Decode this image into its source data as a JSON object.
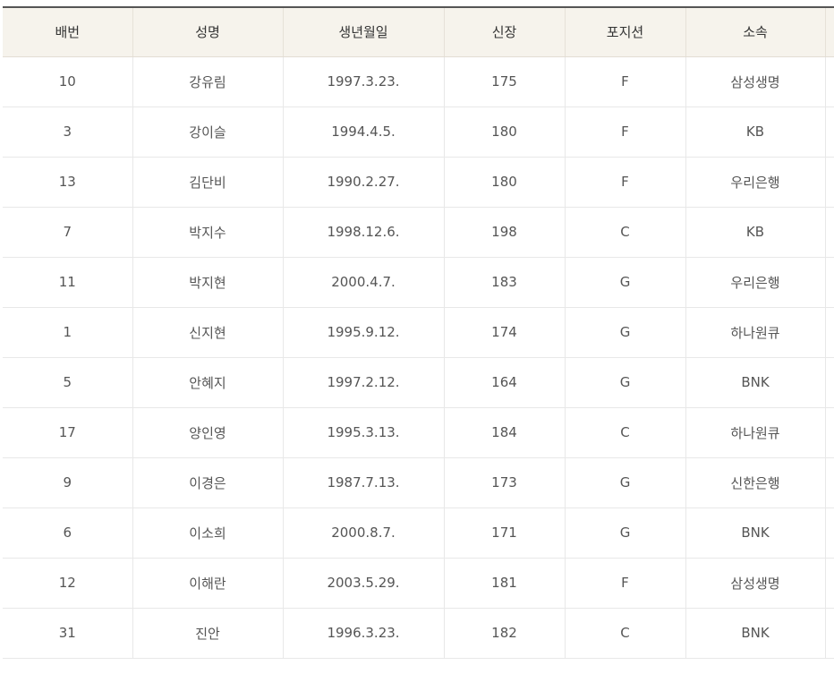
{
  "table": {
    "headers": [
      "배번",
      "성명",
      "생년월일",
      "신장",
      "포지션",
      "소속"
    ],
    "rows": [
      [
        "10",
        "강유림",
        "1997.3.23.",
        "175",
        "F",
        "삼성생명"
      ],
      [
        "3",
        "강이슬",
        "1994.4.5.",
        "180",
        "F",
        "KB"
      ],
      [
        "13",
        "김단비",
        "1990.2.27.",
        "180",
        "F",
        "우리은행"
      ],
      [
        "7",
        "박지수",
        "1998.12.6.",
        "198",
        "C",
        "KB"
      ],
      [
        "11",
        "박지현",
        "2000.4.7.",
        "183",
        "G",
        "우리은행"
      ],
      [
        "1",
        "신지현",
        "1995.9.12.",
        "174",
        "G",
        "하나원큐"
      ],
      [
        "5",
        "안혜지",
        "1997.2.12.",
        "164",
        "G",
        "BNK"
      ],
      [
        "17",
        "양인영",
        "1995.3.13.",
        "184",
        "C",
        "하나원큐"
      ],
      [
        "9",
        "이경은",
        "1987.7.13.",
        "173",
        "G",
        "신한은행"
      ],
      [
        "6",
        "이소희",
        "2000.8.7.",
        "171",
        "G",
        "BNK"
      ],
      [
        "12",
        "이해란",
        "2003.5.29.",
        "181",
        "F",
        "삼성생명"
      ],
      [
        "31",
        "진안",
        "1996.3.23.",
        "182",
        "C",
        "BNK"
      ]
    ]
  }
}
